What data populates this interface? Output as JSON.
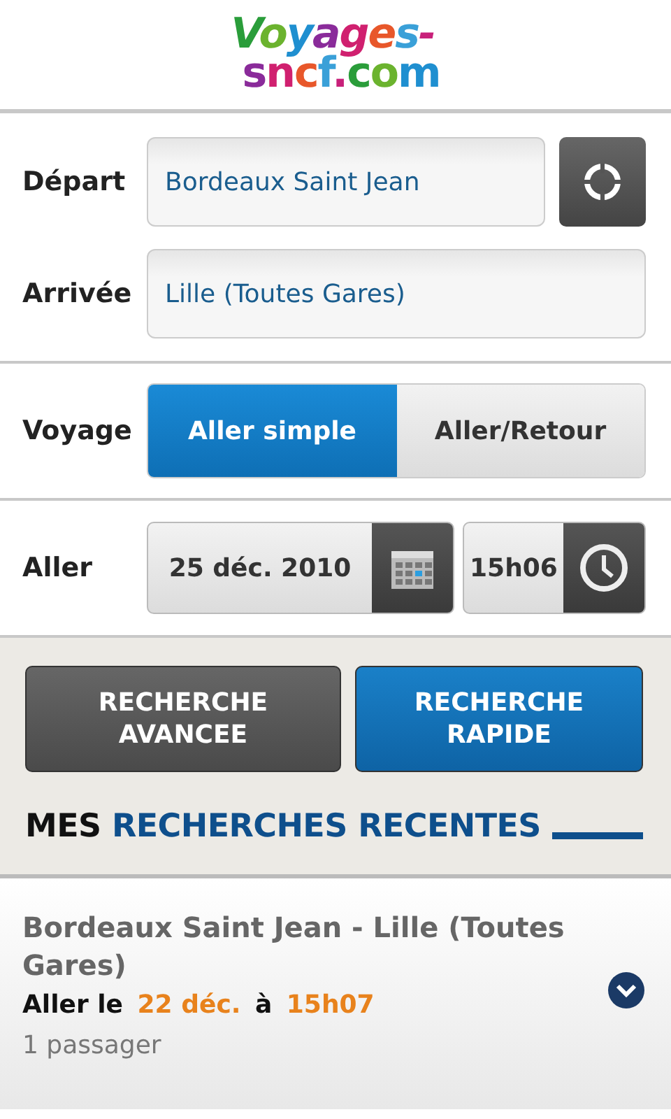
{
  "logo": {
    "line_1": "Voyages-",
    "line_2": "sncf.com"
  },
  "route": {
    "depart_label": "Départ",
    "depart_value": "Bordeaux Saint Jean",
    "arrivee_label": "Arrivée",
    "arrivee_value": "Lille (Toutes Gares)"
  },
  "voyage": {
    "label": "Voyage",
    "options": [
      {
        "label": "Aller simple",
        "selected": true
      },
      {
        "label": "Aller/Retour",
        "selected": false
      }
    ]
  },
  "aller": {
    "label": "Aller",
    "date": "25 déc. 2010",
    "time": "15h06"
  },
  "buttons": [
    {
      "label": "RECHERCHE AVANCEE",
      "kind": "secondary"
    },
    {
      "label": "RECHERCHE RAPIDE",
      "kind": "primary"
    }
  ],
  "recent": {
    "title_lead": "MES",
    "title_main": "RECHERCHES RECENTES",
    "items": [
      {
        "route": "Bordeaux Saint Jean - Lille (Toutes Gares)",
        "prefix": "Aller le",
        "date": "22 déc.",
        "at": "à",
        "time": "15h07",
        "passengers": "1 passager"
      }
    ]
  }
}
